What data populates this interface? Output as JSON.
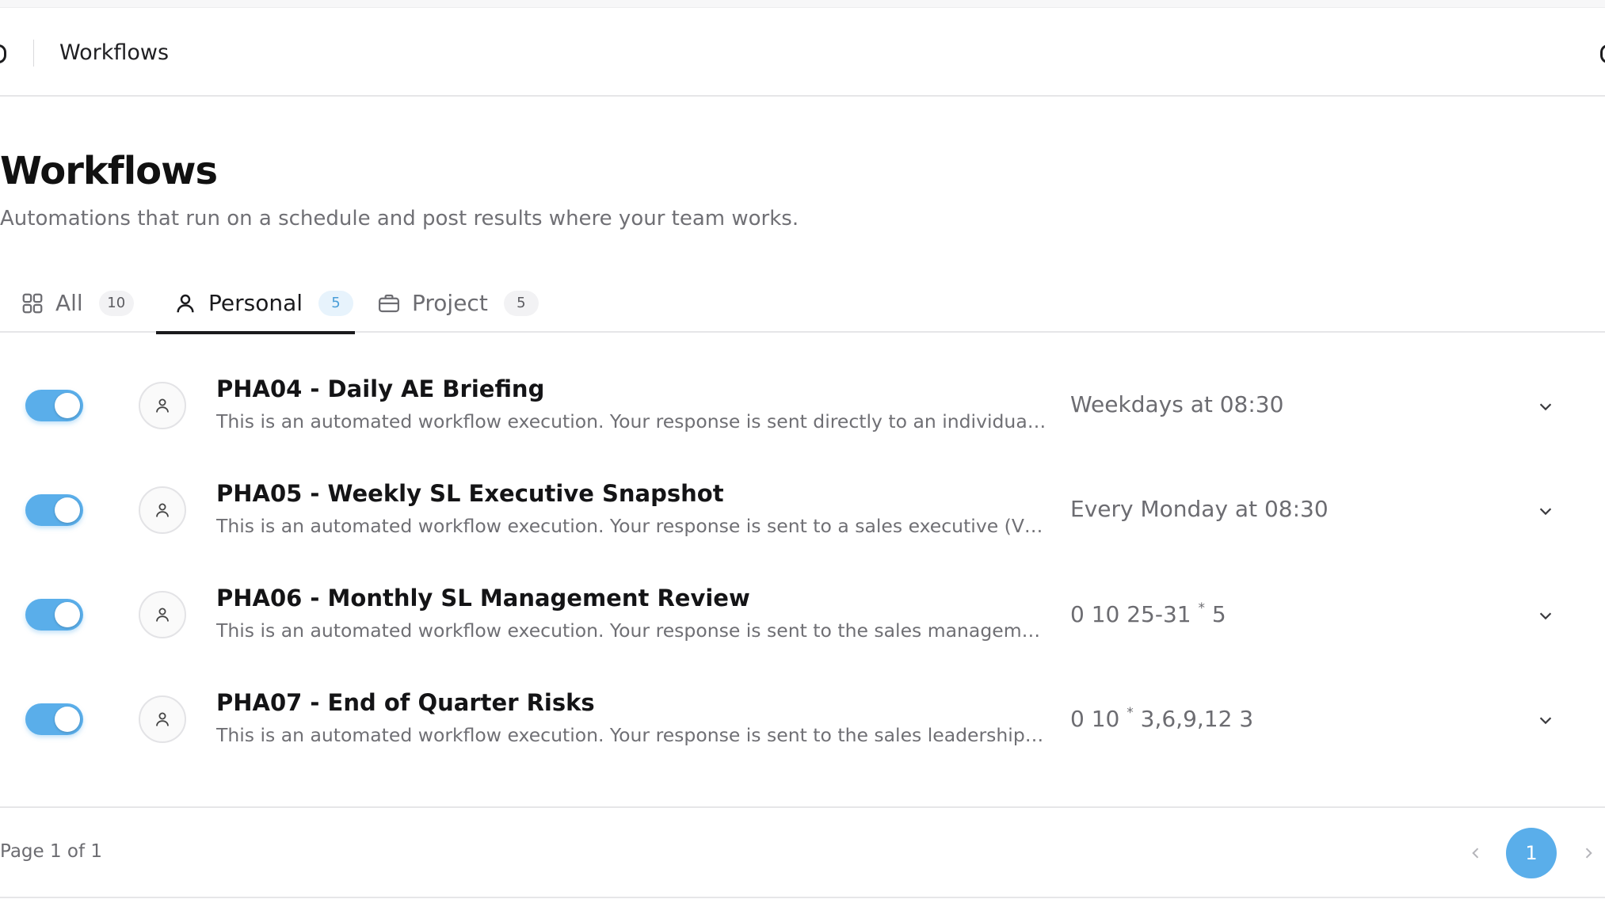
{
  "header": {
    "breadcrumb": "Workflows"
  },
  "page": {
    "title": "Workflows",
    "subtitle": "Automations that run on a schedule and post results where your team works."
  },
  "tabs": [
    {
      "label": "All",
      "count": "10",
      "icon": "grid-icon",
      "active": false
    },
    {
      "label": "Personal",
      "count": "5",
      "icon": "user-icon",
      "active": true
    },
    {
      "label": "Project",
      "count": "5",
      "icon": "briefcase-icon",
      "active": false
    }
  ],
  "workflows": [
    {
      "enabled": true,
      "title": "PHA04 - Daily AE Briefing",
      "description": "This is an automated workflow execution. Your response is sent directly to an individual user (S...",
      "schedule": "Weekdays at 08:30"
    },
    {
      "enabled": true,
      "title": "PHA05 - Weekly SL Executive Snapshot",
      "description": "This is an automated workflow execution. Your response is sent to a sales executive (VP Sales, ...",
      "schedule": "Every Monday at 08:30"
    },
    {
      "enabled": true,
      "title": "PHA06 - Monthly SL Management Review",
      "description": "This is an automated workflow execution. Your response is sent to the sales management tea...",
      "schedule_parts": [
        "0 10 25-31",
        "*",
        "5"
      ]
    },
    {
      "enabled": true,
      "title": "PHA07 - End of Quarter Risks",
      "description": "This is an automated workflow execution. Your response is sent to the sales leadership team vi...",
      "schedule_parts": [
        "0 10",
        "*",
        "3,6,9,12 3"
      ]
    }
  ],
  "pagination": {
    "info": "Page 1 of 1",
    "current": "1"
  },
  "colors": {
    "accent": "#5aaeea",
    "text": "#1c1c1e",
    "muted": "#6f6f74",
    "border": "#e6e6e8"
  }
}
